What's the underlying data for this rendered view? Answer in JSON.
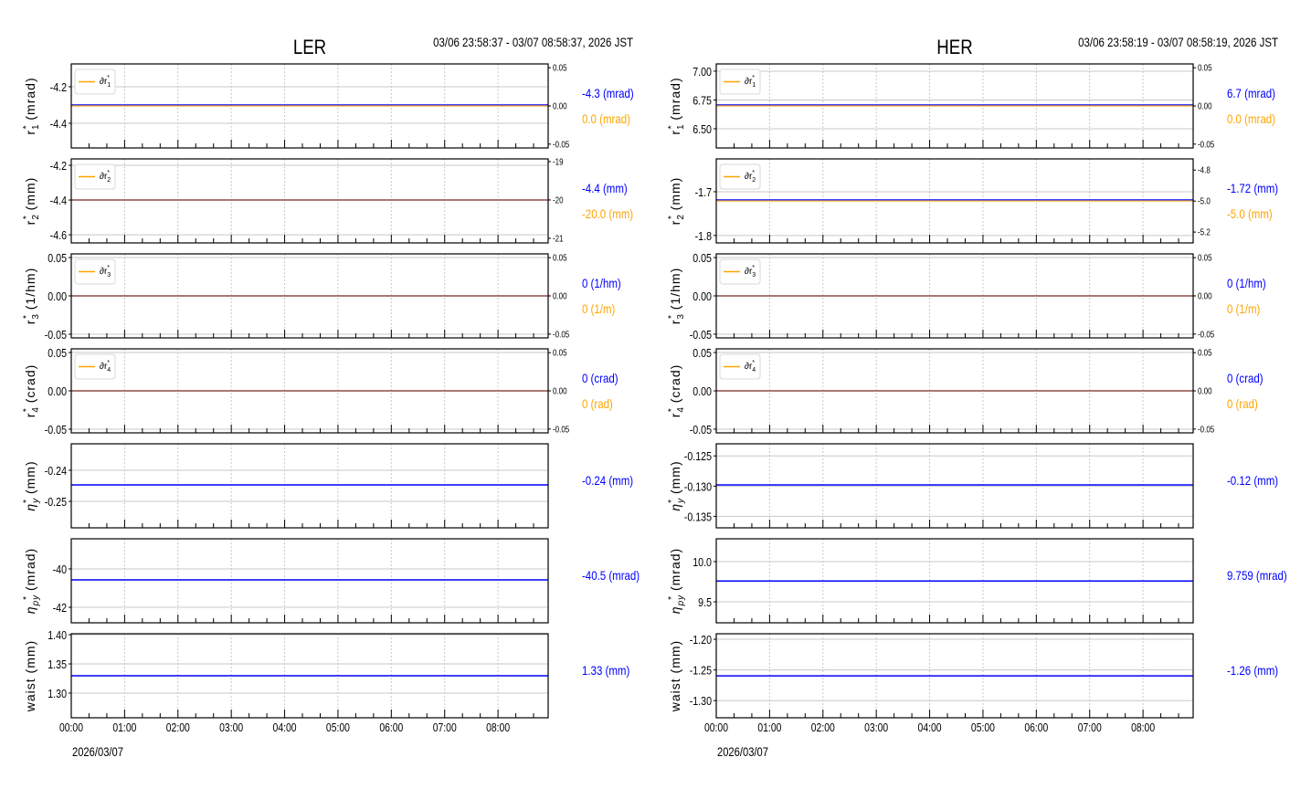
{
  "colors": {
    "main": "#0000ff",
    "delta": "#ffa500",
    "grid": "#c8c8c8",
    "frame": "#000000"
  },
  "chart_data": [
    {
      "type": "line",
      "title": "LER",
      "time_range": "03/06 23:58:37 - 03/07 08:58:37, 2026 JST",
      "date_label": "2026/03/07",
      "x_ticks": [
        "00:00",
        "01:00",
        "02:00",
        "03:00",
        "04:00",
        "05:00",
        "06:00",
        "07:00",
        "08:00"
      ],
      "xlim_hours": [
        0,
        8.94
      ],
      "panels": [
        {
          "ylabel": {
            "sym": "r",
            "sub": "1",
            "unit": "(mrad)"
          },
          "ylim": [
            -4.535,
            -4.075
          ],
          "yticks": [
            "-4.2",
            "-4.4"
          ],
          "ytick_values": [
            -4.2,
            -4.4
          ],
          "value": -4.3,
          "value_label": "-4.3 (mrad)",
          "delta": {
            "legend": "∂r",
            "sub": "1",
            "ylim": [
              -0.055,
              0.055
            ],
            "yticks": [
              "0.05",
              "0.00",
              "-0.05"
            ],
            "ytick_values": [
              0.05,
              0,
              -0.05
            ],
            "value": 0.0,
            "value_label": "0.0 (mrad)"
          }
        },
        {
          "ylabel": {
            "sym": "r",
            "sub": "2",
            "unit": "(mm)"
          },
          "ylim": [
            -4.647,
            -4.163
          ],
          "yticks": [
            "-4.2",
            "-4.4",
            "-4.6"
          ],
          "ytick_values": [
            -4.2,
            -4.4,
            -4.6
          ],
          "value": -4.4,
          "value_label": "-4.4 (mm)",
          "delta": {
            "legend": "∂r",
            "sub": "2",
            "ylim": [
              -21.12,
              -18.93
            ],
            "yticks": [
              "-19",
              "-20",
              "-21"
            ],
            "ytick_values": [
              -19,
              -20,
              -21
            ],
            "value": -20.0,
            "value_label": "-20.0 (mm)"
          }
        },
        {
          "ylabel": {
            "sym": "r",
            "sub": "3",
            "unit": "(1/hm)"
          },
          "ylim": [
            -0.0548,
            0.0548
          ],
          "yticks": [
            "0.05",
            "0.00",
            "-0.05"
          ],
          "ytick_values": [
            0.05,
            0,
            -0.05
          ],
          "value": 0,
          "value_label": "0 (1/hm)",
          "delta": {
            "legend": "∂r",
            "sub": "3",
            "ylim": [
              -0.055,
              0.055
            ],
            "yticks": [
              "0.05",
              "0.00",
              "-0.05"
            ],
            "ytick_values": [
              0.05,
              0,
              -0.05
            ],
            "value": 0,
            "value_label": "0 (1/m)"
          }
        },
        {
          "ylabel": {
            "sym": "r",
            "sub": "4",
            "unit": "(crad)"
          },
          "ylim": [
            -0.0548,
            0.0548
          ],
          "yticks": [
            "0.05",
            "0.00",
            "-0.05"
          ],
          "ytick_values": [
            0.05,
            0,
            -0.05
          ],
          "value": 0,
          "value_label": "0 (crad)",
          "delta": {
            "legend": "∂r",
            "sub": "4",
            "ylim": [
              -0.055,
              0.055
            ],
            "yticks": [
              "0.05",
              "0.00",
              "-0.05"
            ],
            "ytick_values": [
              0.05,
              0,
              -0.05
            ],
            "value": 0,
            "value_label": "0 (rad)"
          }
        },
        {
          "ylabel": {
            "sym": "η",
            "sub": "y",
            "unit": "(mm)"
          },
          "ylim": [
            -0.2585,
            -0.2315
          ],
          "yticks": [
            "-0.24",
            "-0.25"
          ],
          "ytick_values": [
            -0.24,
            -0.25
          ],
          "value": -0.2447,
          "value_label": "-0.24 (mm)"
        },
        {
          "ylabel": {
            "sym": "η",
            "sub": "py",
            "unit": "(mrad)"
          },
          "ylim": [
            -42.81,
            -38.43
          ],
          "yticks": [
            "-40",
            "-42"
          ],
          "ytick_values": [
            -40,
            -42
          ],
          "value": -40.57,
          "value_label": "-40.5 (mrad)"
        },
        {
          "ylabel": {
            "sym": "waist",
            "sub": "",
            "unit": "(mm)"
          },
          "ylim": [
            1.2578,
            1.4016
          ],
          "yticks": [
            "1.40",
            "1.35",
            "1.30"
          ],
          "ytick_values": [
            1.4,
            1.35,
            1.3
          ],
          "value": 1.3297,
          "value_label": "1.33 (mm)"
        }
      ]
    },
    {
      "type": "line",
      "title": "HER",
      "time_range": "03/06 23:58:19 - 03/07 08:58:19, 2026 JST",
      "date_label": "2026/03/07",
      "x_ticks": [
        "00:00",
        "01:00",
        "02:00",
        "03:00",
        "04:00",
        "05:00",
        "06:00",
        "07:00",
        "08:00"
      ],
      "xlim_hours": [
        0,
        8.94
      ],
      "panels": [
        {
          "ylabel": {
            "sym": "r",
            "sub": "1",
            "unit": "(mrad)"
          },
          "ylim": [
            6.333,
            7.063
          ],
          "yticks": [
            "7.00",
            "6.75",
            "6.50"
          ],
          "ytick_values": [
            7.0,
            6.75,
            6.5
          ],
          "value": 6.706,
          "value_label": "6.7 (mrad)",
          "delta": {
            "legend": "∂r",
            "sub": "1",
            "ylim": [
              -0.055,
              0.055
            ],
            "yticks": [
              "0.05",
              "0.00",
              "-0.05"
            ],
            "ytick_values": [
              0.05,
              0,
              -0.05
            ],
            "value": 0.0,
            "value_label": "0.0 (mrad)"
          }
        },
        {
          "ylabel": {
            "sym": "r",
            "sub": "2",
            "unit": "(mm)"
          },
          "ylim": [
            -1.817,
            -1.625
          ],
          "yticks": [
            "-1.7",
            "-1.8"
          ],
          "ytick_values": [
            -1.7,
            -1.8
          ],
          "value": -1.719,
          "value_label": "-1.72 (mm)",
          "delta": {
            "legend": "∂r",
            "sub": "2",
            "ylim": [
              -5.27,
              -4.728
            ],
            "yticks": [
              "-4.8",
              "-5.0",
              "-5.2"
            ],
            "ytick_values": [
              -4.8,
              -5.0,
              -5.2
            ],
            "value": -5.0,
            "value_label": "-5.0 (mm)"
          }
        },
        {
          "ylabel": {
            "sym": "r",
            "sub": "3",
            "unit": "(1/hm)"
          },
          "ylim": [
            -0.0548,
            0.0548
          ],
          "yticks": [
            "0.05",
            "0.00",
            "-0.05"
          ],
          "ytick_values": [
            0.05,
            0,
            -0.05
          ],
          "value": 0,
          "value_label": "0 (1/hm)",
          "delta": {
            "legend": "∂r",
            "sub": "3",
            "ylim": [
              -0.055,
              0.055
            ],
            "yticks": [
              "0.05",
              "0.00",
              "-0.05"
            ],
            "ytick_values": [
              0.05,
              0,
              -0.05
            ],
            "value": 0,
            "value_label": "0 (1/m)"
          }
        },
        {
          "ylabel": {
            "sym": "r",
            "sub": "4",
            "unit": "(crad)"
          },
          "ylim": [
            -0.0548,
            0.0548
          ],
          "yticks": [
            "0.05",
            "0.00",
            "-0.05"
          ],
          "ytick_values": [
            0.05,
            0,
            -0.05
          ],
          "value": 0,
          "value_label": "0 (crad)",
          "delta": {
            "legend": "∂r",
            "sub": "4",
            "ylim": [
              -0.055,
              0.055
            ],
            "yticks": [
              "0.05",
              "0.00",
              "-0.05"
            ],
            "ytick_values": [
              0.05,
              0,
              -0.05
            ],
            "value": 0,
            "value_label": "0 (rad)"
          }
        },
        {
          "ylabel": {
            "sym": "η",
            "sub": "y",
            "unit": "(mm)"
          },
          "ylim": [
            -0.1369,
            -0.123
          ],
          "yticks": [
            "-0.125",
            "-0.130",
            "-0.135"
          ],
          "ytick_values": [
            -0.125,
            -0.13,
            -0.135
          ],
          "value": -0.1298,
          "value_label": "-0.12 (mm)"
        },
        {
          "ylabel": {
            "sym": "η",
            "sub": "py",
            "unit": "(mrad)"
          },
          "ylim": [
            9.239,
            10.284
          ],
          "yticks": [
            "10.0",
            "9.5"
          ],
          "ytick_values": [
            10.0,
            9.5
          ],
          "value": 9.759,
          "value_label": "9.759 (mrad)"
        },
        {
          "ylabel": {
            "sym": "waist",
            "sub": "",
            "unit": "(mm)"
          },
          "ylim": [
            -1.328,
            -1.191
          ],
          "yticks": [
            "-1.20",
            "-1.25",
            "-1.30"
          ],
          "ytick_values": [
            -1.2,
            -1.25,
            -1.3
          ],
          "value": -1.2597,
          "value_label": "-1.26 (mm)"
        }
      ]
    }
  ]
}
